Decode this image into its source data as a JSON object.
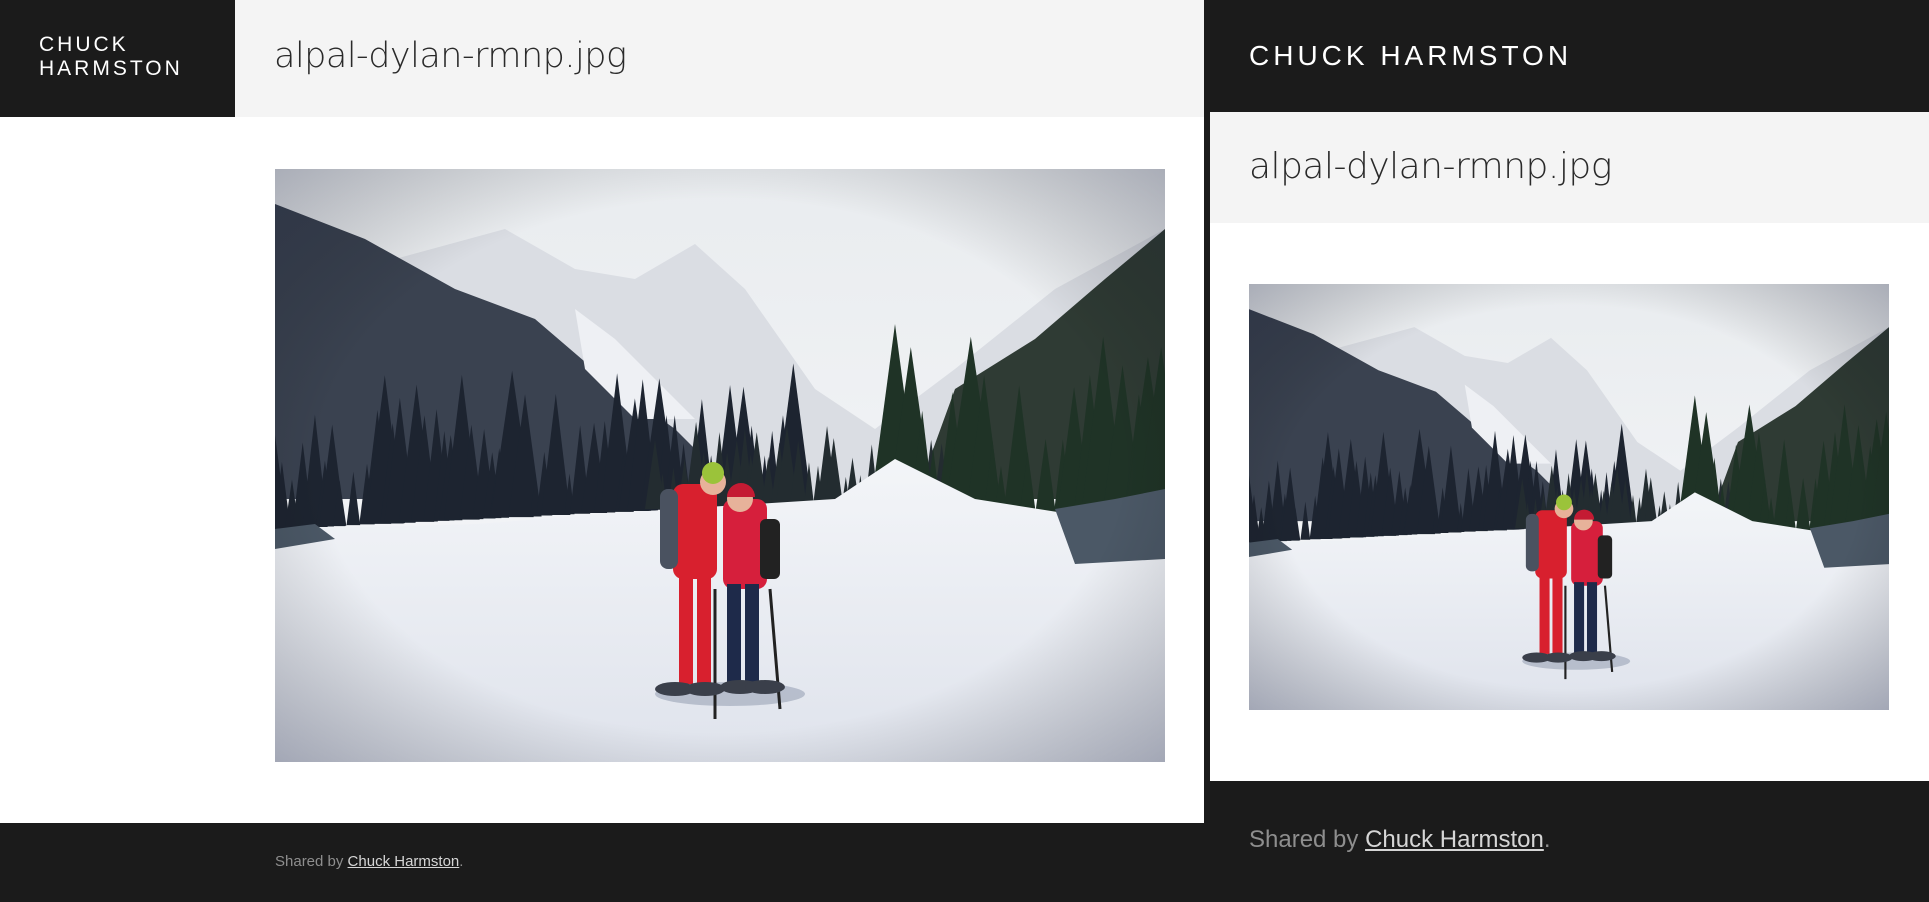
{
  "left": {
    "brand": [
      "CHUCK",
      "HARMSTON"
    ],
    "title": "alpal-dylan-rmnp.jpg",
    "footer": {
      "prefix": "Shared by ",
      "link": "Chuck Harmston",
      "suffix": "."
    }
  },
  "right": {
    "brand": "CHUCK HARMSTON",
    "title": "alpal-dylan-rmnp.jpg",
    "footer": {
      "prefix": "Shared by ",
      "link": "Chuck Harmston",
      "suffix": "."
    }
  },
  "colors": {
    "dark": "#1b1b1b",
    "header_bg": "#f4f4f4",
    "link": "#d6d6d6",
    "muted": "#8e8e8e"
  },
  "photo": {
    "subject": "two-hikers-snowshoeing-in-mountain-snowfield"
  }
}
